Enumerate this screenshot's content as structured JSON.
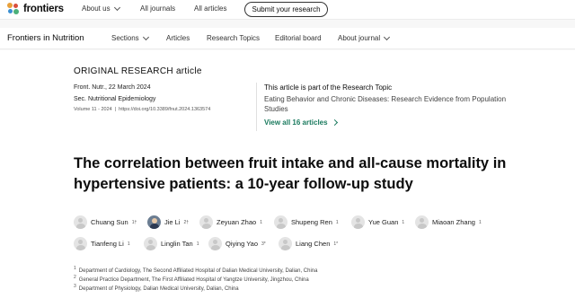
{
  "topbar": {
    "logo_text": "frontiers",
    "nav": [
      {
        "label": "About us",
        "dropdown": true
      },
      {
        "label": "All journals",
        "dropdown": false
      },
      {
        "label": "All articles",
        "dropdown": false
      }
    ],
    "submit_label": "Submit your research"
  },
  "journalbar": {
    "name": "Frontiers in Nutrition",
    "nav": [
      {
        "label": "Sections",
        "dropdown": true
      },
      {
        "label": "Articles",
        "dropdown": false
      },
      {
        "label": "Research Topics",
        "dropdown": false
      },
      {
        "label": "Editorial board",
        "dropdown": false
      },
      {
        "label": "About journal",
        "dropdown": true
      }
    ]
  },
  "article": {
    "type": "ORIGINAL RESEARCH article",
    "journal_date": "Front. Nutr., 22 March 2024",
    "section": "Sec. Nutritional Epidemiology",
    "volume": "Volume 11 - 2024",
    "separator": "|",
    "doi": "https://doi.org/10.3389/fnut.2024.1363574",
    "title": "The correlation between fruit intake and all-cause mortality in hypertensive patients: a 10-year follow-up study",
    "research_topic": {
      "heading": "This article is part of the Research Topic",
      "title": "Eating Behavior and Chronic Diseases: Research Evidence from Population Studies",
      "link_label": "View all 16 articles"
    },
    "authors": [
      {
        "name": "Chuang Sun",
        "sup": "1†",
        "photo": false
      },
      {
        "name": "Jie Li",
        "sup": "2†",
        "photo": true
      },
      {
        "name": "Zeyuan Zhao",
        "sup": "1",
        "photo": false
      },
      {
        "name": "Shupeng Ren",
        "sup": "1",
        "photo": false
      },
      {
        "name": "Yue Guan",
        "sup": "1",
        "photo": false
      },
      {
        "name": "Miaoan Zhang",
        "sup": "1",
        "photo": false
      },
      {
        "name": "Tianfeng Li",
        "sup": "1",
        "photo": false
      },
      {
        "name": "Linglin Tan",
        "sup": "1",
        "photo": false
      },
      {
        "name": "Qiying Yao",
        "sup": "3*",
        "photo": false
      },
      {
        "name": "Liang Chen",
        "sup": "1*",
        "photo": false
      }
    ],
    "affiliations": [
      {
        "num": "1",
        "text": "Department of Cardiology, The Second Affiliated Hospital of Dalian Medical University, Dalian, China"
      },
      {
        "num": "2",
        "text": "General Practice Department, The First Affiliated Hospital of Yangtze University, Jingzhou, China"
      },
      {
        "num": "3",
        "text": "Department of Physiology, Dalian Medical University, Dalian, China"
      }
    ]
  },
  "colors": {
    "accent_link": "#1a7a5e",
    "logo_palette": [
      "#e8a03a",
      "#d94f3d",
      "#3a8fd1",
      "#4bb07a"
    ]
  }
}
